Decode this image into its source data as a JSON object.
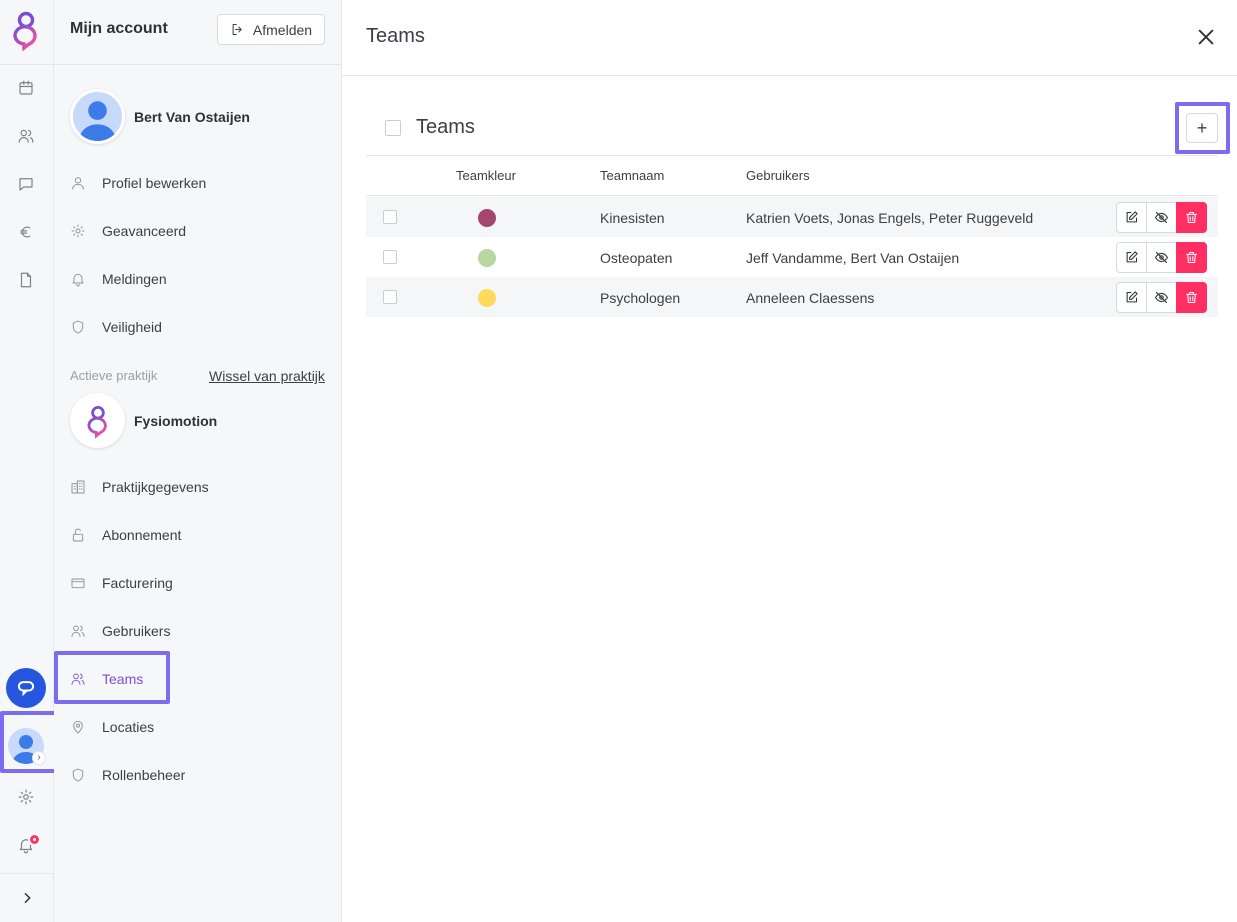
{
  "account": {
    "title": "Mijn account",
    "logout_label": "Afmelden",
    "user_name": "Bert Van Ostaijen",
    "user_menu": [
      {
        "label": "Profiel bewerken",
        "icon": "user-icon"
      },
      {
        "label": "Geavanceerd",
        "icon": "gear-icon"
      },
      {
        "label": "Meldingen",
        "icon": "bell-icon"
      },
      {
        "label": "Veiligheid",
        "icon": "shield-icon"
      }
    ],
    "practice_label": "Actieve praktijk",
    "switch_practice_label": "Wissel van praktijk",
    "practice_name": "Fysiomotion",
    "practice_menu": [
      {
        "label": "Praktijkgegevens",
        "icon": "building-icon"
      },
      {
        "label": "Abonnement",
        "icon": "lock-icon"
      },
      {
        "label": "Facturering",
        "icon": "credit-card-icon"
      },
      {
        "label": "Gebruikers",
        "icon": "users-icon"
      },
      {
        "label": "Teams",
        "icon": "users-icon",
        "active": true
      },
      {
        "label": "Locaties",
        "icon": "map-pin-icon"
      },
      {
        "label": "Rollenbeheer",
        "icon": "shield-icon"
      }
    ]
  },
  "main": {
    "title": "Teams",
    "section_title": "Teams",
    "add_label": "+",
    "columns": [
      "Teamkleur",
      "Teamnaam",
      "Gebruikers"
    ],
    "rows": [
      {
        "color": "#a3476f",
        "name": "Kinesisten",
        "users": "Katrien Voets, Jonas Engels, Peter Ruggeveld"
      },
      {
        "color": "#b6d7a0",
        "name": "Osteopaten",
        "users": "Jeff Vandamme, Bert Van Ostaijen"
      },
      {
        "color": "#ffd95a",
        "name": "Psychologen",
        "users": "Anneleen Claessens"
      }
    ]
  },
  "colors": {
    "accent": "#7b6cf0",
    "active_menu": "#7a4fd3",
    "delete": "#ff2e63",
    "chat": "#2656e0",
    "badge": "#ff3366"
  }
}
